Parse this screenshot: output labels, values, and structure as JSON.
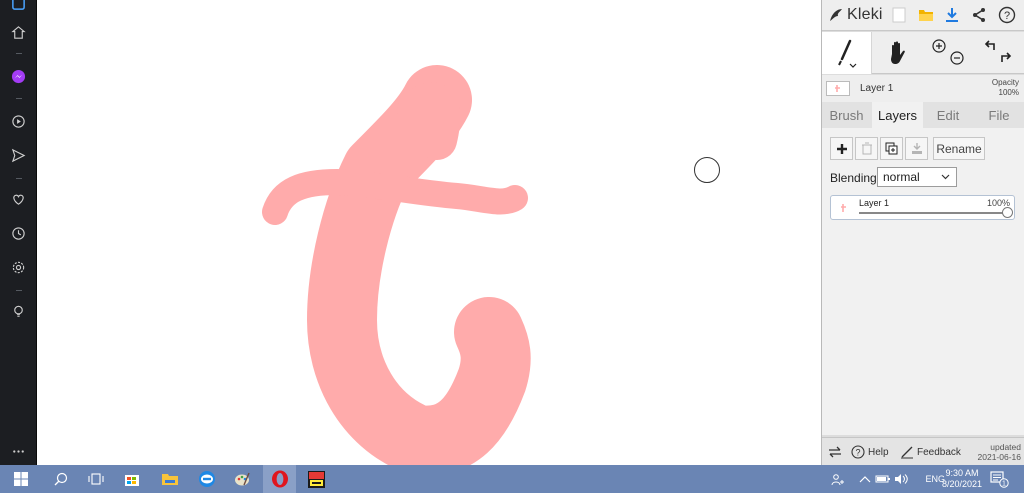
{
  "app": {
    "name": "Kleki"
  },
  "colors": {
    "stroke": "#ffabab",
    "panel_bg": "#dddddd",
    "taskbar_bg": "#6a85b4",
    "sidebar_bg": "#1c1e22"
  },
  "left_sidebar": {
    "icons": [
      "app-icon",
      "home-icon",
      "messenger-icon",
      "play-icon",
      "send-icon",
      "heart-icon",
      "clock-icon",
      "settings-icon",
      "lightbulb-icon",
      "more-icon"
    ]
  },
  "toolbar": {
    "tools": [
      "brush-tool",
      "hand-tool",
      "zoom-in-icon",
      "zoom-out-icon",
      "undo-icon",
      "redo-icon"
    ],
    "top_icons": [
      "new-image-icon",
      "open-folder-icon",
      "download-icon",
      "share-icon",
      "help-icon"
    ]
  },
  "layer_preview": {
    "name": "Layer 1",
    "opacity_label": "Opacity",
    "opacity_value": "100%"
  },
  "tabs": [
    {
      "label": "Brush",
      "active": false
    },
    {
      "label": "Layers",
      "active": true
    },
    {
      "label": "Edit",
      "active": false
    },
    {
      "label": "File",
      "active": false
    }
  ],
  "layers": {
    "rename_label": "Rename",
    "blending_label": "Blending",
    "blending_value": "normal",
    "items": [
      {
        "name": "Layer 1",
        "opacity": "100%",
        "opacity_fraction": 1.0
      }
    ]
  },
  "bottom": {
    "help_label": "Help",
    "feedback_label": "Feedback",
    "updated_label": "updated",
    "updated_date": "2021-06-16"
  },
  "taskbar": {
    "apps": [
      "windows-start-icon",
      "search-icon",
      "task-view-icon",
      "store-icon",
      "file-explorer-icon",
      "zalo-icon",
      "paint-icon",
      "opera-icon",
      "game-icon"
    ],
    "tray_lang": "ENG",
    "time": "9:30 AM",
    "date": "8/20/2021",
    "notification_count": "1"
  }
}
